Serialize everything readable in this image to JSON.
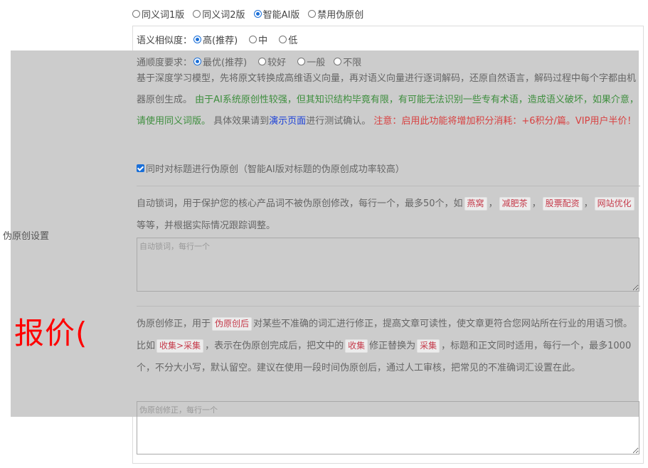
{
  "mode_options": [
    {
      "label": "同义词1版",
      "checked": false
    },
    {
      "label": "同义词2版",
      "checked": false
    },
    {
      "label": "智能AI版",
      "checked": true
    },
    {
      "label": "禁用伪原创",
      "checked": false
    }
  ],
  "similarity": {
    "label": "语义相似度：",
    "options": [
      {
        "label": "高(推荐)",
        "checked": true
      },
      {
        "label": "中",
        "checked": false
      },
      {
        "label": "低",
        "checked": false
      }
    ]
  },
  "fluency": {
    "label": "通顺度要求：",
    "options": [
      {
        "label": "最优(推荐)",
        "checked": true
      },
      {
        "label": "较好",
        "checked": false
      },
      {
        "label": "一般",
        "checked": false
      },
      {
        "label": "不限",
        "checked": false
      }
    ]
  },
  "description": {
    "part1": "基于深度学习模型，先将原文转换成高维语义向量，再对语义向量进行逐词解码，还原自然语言，解码过程中每个字都由机器原创生成。",
    "part2_green": "由于AI系统原创性较强，但其知识结构毕竟有限，有可能无法识别一些专有术语，造成语义破坏，如果介意，请使用同义词版。",
    "part3": "具体效果请到",
    "part3_link": "演示页面",
    "part3_end": "进行测试确认。",
    "part4_red": "注意：启用此功能将增加积分消耗：+6积分/篇。VIP用户半价！"
  },
  "title_checkbox": {
    "label": "同时对标题进行伪原创（智能AI版对标题的伪原创成功率较高）",
    "checked": true
  },
  "section_label": "伪原创设置",
  "overlay_text": "报价(",
  "lock_words": {
    "text1": "自动锁词，用于保护您的核心产品词不被伪原创修改，每行一个，最多50个，如",
    "examples": [
      "燕窝",
      "减肥茶",
      "股票配资",
      "网站优化"
    ],
    "sep": "，",
    "text2": "等等，并根据实际情况跟踪调整。",
    "placeholder": "自动锁词，每行一个"
  },
  "correction": {
    "text1": "伪原创修正，用于",
    "tag1": "伪原创后",
    "text2": "对某些不准确的词汇进行修正，提高文章可读性，使文章更符合您网站所在行业的用语习惯。比如",
    "tag2": "收集>采集",
    "text3": "，表示在伪原创完成后，把文中的",
    "tag3": "收集",
    "text4": "修正替换为",
    "tag4": "采集",
    "text5": "，标题和正文同时适用，每行一个，最多1000个，不分大小写，默认留空。建议在使用一段时间伪原创后，通过人工审核，把常见的不准确词汇设置在此。",
    "placeholder": "伪原创修正，每行一个"
  }
}
